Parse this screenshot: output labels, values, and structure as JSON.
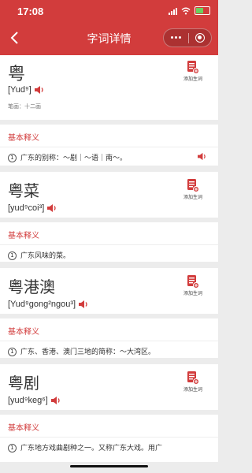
{
  "status": {
    "time": "17:08"
  },
  "nav": {
    "title": "字词详情"
  },
  "add_label": "添加生词",
  "basic_label": "基本释义",
  "entries": [
    {
      "word": "粤",
      "pinyin": "[Yud⁹]",
      "strokes": "笔画：十二画",
      "defs": [
        {
          "num": "1",
          "text": "广东的别称：～剧｜～语｜南～。"
        }
      ]
    },
    {
      "word": "粤菜",
      "pinyin": "[yud⁹coi³]",
      "defs": [
        {
          "num": "1",
          "text": "广东风味的菜。"
        }
      ]
    },
    {
      "word": "粤港澳",
      "pinyin": "[Yud⁹gong²ngou³]",
      "defs": [
        {
          "num": "1",
          "text": "广东、香港、澳门三地的简称：～大湾区。"
        }
      ]
    },
    {
      "word": "粤剧",
      "pinyin": "[yud⁹keg⁶]",
      "defs": [
        {
          "num": "1",
          "text": "广东地方戏曲剧种之一。又称广东大戏。用广"
        }
      ]
    }
  ],
  "colors": {
    "accent": "#d23c3c",
    "background": "#ececec"
  }
}
